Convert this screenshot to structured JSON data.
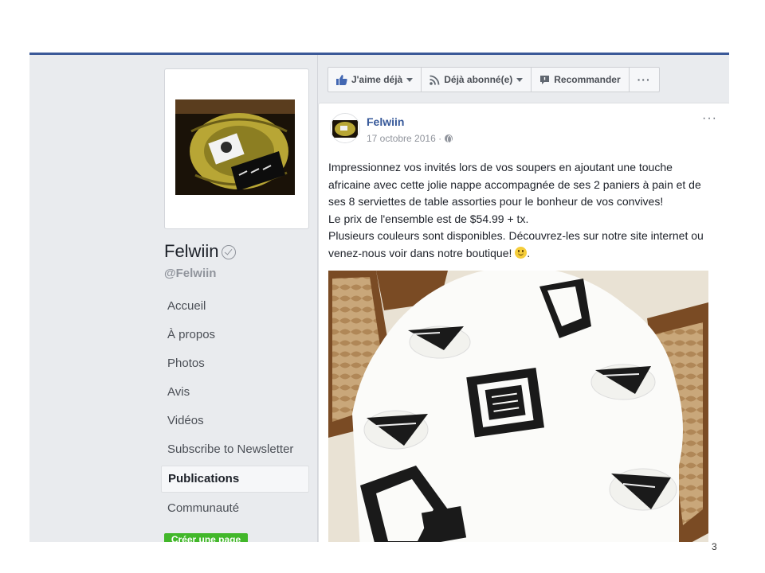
{
  "page": {
    "name": "Felwiin",
    "handle": "@Felwiin",
    "nav": [
      "Accueil",
      "À propos",
      "Photos",
      "Avis",
      "Vidéos",
      "Subscribe to Newsletter",
      "Publications",
      "Communauté"
    ],
    "active_nav": "Publications",
    "create_page_button": "Créer une page"
  },
  "actions": {
    "like": "J'aime déjà",
    "follow": "Déjà abonné(e)",
    "recommend": "Recommander",
    "more": "···"
  },
  "post": {
    "author": "Felwiin",
    "date": "17 octobre 2016 ·",
    "menu": "···",
    "paragraphs": [
      "Impressionnez vos invités lors de vos soupers en ajoutant une touche africaine avec cette jolie nappe accompagnée de ses 2 paniers à pain et de ses 8 serviettes de table assorties pour le bonheur de vos convives!",
      "Le prix de l'ensemble est de $54.99 + tx.",
      "Plusieurs couleurs sont disponibles. Découvrez-les sur notre site internet ou venez-nous voir dans notre boutique!"
    ],
    "ending": "."
  },
  "icons": {
    "like": "thumbs-up-icon",
    "follow": "rss-icon",
    "recommend": "speech-bubble-icon",
    "verified": "verified-check-icon",
    "privacy": "globe-icon"
  },
  "colors": {
    "accent": "#3b5998",
    "link": "#365899",
    "background": "#e9ebee",
    "create_button": "#42b72a"
  },
  "slide_number": "3"
}
